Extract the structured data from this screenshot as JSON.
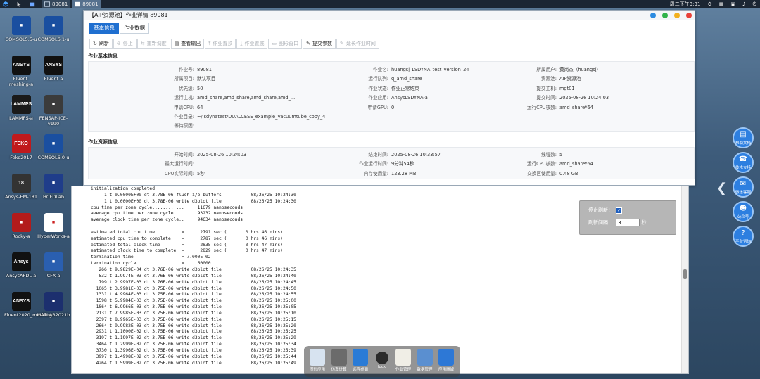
{
  "taskbar": {
    "tasks": [
      "89081",
      "89081"
    ],
    "clock": "周二下午3:31"
  },
  "desktop_icons": [
    {
      "label": "COMSOL5.5-u",
      "badge": "",
      "color": "#1a4fa0"
    },
    {
      "label": "COMSOL6.1-u",
      "badge": "",
      "color": "#1a4fa0"
    },
    {
      "label": "Fluent-meshing-a",
      "badge": "ANSYS",
      "color": "#111111"
    },
    {
      "label": "Fluent-a",
      "badge": "ANSYS",
      "color": "#111111"
    },
    {
      "label": "LAMMPS-a",
      "badge": "LAMMPS",
      "color": "#1a1a1a"
    },
    {
      "label": "FENSAP-ICE-v190",
      "badge": "",
      "color": "#3b3b3b"
    },
    {
      "label": "Feko2017",
      "badge": "FEKO",
      "color": "#c0191c"
    },
    {
      "label": "COMSOL6.0-u",
      "badge": "",
      "color": "#1a4fa0"
    },
    {
      "label": "Ansys-EM-181",
      "badge": "18",
      "color": "#333333"
    },
    {
      "label": "HCFDLab",
      "badge": "",
      "color": "#1f3d8a"
    },
    {
      "label": "Rocky-a",
      "badge": "",
      "color": "#b31b1b"
    },
    {
      "label": "HyperWorks-a",
      "badge": "",
      "color": "#ffffff"
    },
    {
      "label": "AnsysAPDL-a",
      "badge": "Ansys",
      "color": "#111111"
    },
    {
      "label": "CFX-a",
      "badge": "",
      "color": "#2a5fb0"
    },
    {
      "label": "Fluent2020_meshing",
      "badge": "ANSYS",
      "color": "#111111"
    },
    {
      "label": "MATLAB2021b",
      "badge": "",
      "color": "#1c2f6e"
    }
  ],
  "window": {
    "title": "【AIP资源池】作业详情 89081",
    "tabs": [
      "基本信息",
      "作业数据"
    ],
    "toolbar": [
      "刷新",
      "停止",
      "重新调度",
      "查看输出",
      "作业置顶",
      "作业置底",
      "图形窗口",
      "提交参数",
      "延长作业时间"
    ],
    "basic_section": "作业基本信息",
    "basic": {
      "col1": [
        [
          "作业号:",
          "89081"
        ],
        [
          "所属项目:",
          "默认项目"
        ],
        [
          "优先级:",
          "50"
        ],
        [
          "运行主机:",
          "amd_share,amd_share,amd_share,amd_..."
        ],
        [
          "申请CPU:",
          "64"
        ],
        [
          "作业目录:",
          "~/lsdynatest/DUALCESE_example_Vacuumtube_copy_4"
        ],
        [
          "等待原因:",
          ""
        ]
      ],
      "col2": [
        [
          "作业名:",
          "huangsj_LSDYNA_test_version_24"
        ],
        [
          "运行队列:",
          "q_amd_share"
        ],
        [
          "作业状态:",
          "作业正常结束"
        ],
        [
          "作业应用:",
          "AnsysLSDYNA-a"
        ],
        [
          "申请GPU:",
          "0"
        ]
      ],
      "col3": [
        [
          "所属用户:",
          "黄尚杰（huangsj）"
        ],
        [
          "资源池:",
          "AIP资源池"
        ],
        [
          "提交主机:",
          "mgt01"
        ],
        [
          "提交时间:",
          "2025-08-26 10:24:03"
        ],
        [
          "运行CPU核数:",
          "amd_share*64"
        ]
      ]
    },
    "resource_section": "作业资源信息",
    "resource": {
      "col1": [
        [
          "开始时间:",
          "2025-08-26 10:24:03"
        ],
        [
          "最大运行时间:",
          ""
        ],
        [
          "CPU实际时间:",
          "5秒"
        ]
      ],
      "col2": [
        [
          "结束时间:",
          "2025-08-26 10:33:57"
        ],
        [
          "作业运行时间:",
          "9分钟54秒"
        ],
        [
          "内存使用量:",
          "123.28 MB"
        ]
      ],
      "col3": [
        [
          "线程数:",
          "5"
        ],
        [
          "运行CPU核数:",
          "amd_share*64"
        ],
        [
          "交换区使用量:",
          "0.48 GB"
        ]
      ]
    }
  },
  "log": {
    "lines": [
      "initialization completed",
      "     1 t 0.0000E+00 dt 3.78E-06 flush i/o buffers           08/26/25 10:24:30",
      "     1 t 0.0000E+00 dt 3.78E-06 write d3plot file           08/26/25 10:24:30",
      "cpu time per zone cycle............     11679 nanoseconds",
      "average cpu time per zone cycle....     93232 nanoseconds",
      "average clock time per zone cycle..     94634 nanoseconds",
      "",
      "estimated total cpu time          =      2791 sec (       0 hrs 46 mins)",
      "estimated cpu time to complete    =      2787 sec (       0 hrs 46 mins)",
      "estimated total clock time        =      2835 sec (       0 hrs 47 mins)",
      "estimated clock time to complete  =      2829 sec (       0 hrs 47 mins)",
      "termination time                  = 7.000E-02",
      "termination cycle                 =     60000",
      "   266 t 9.9829E-04 dt 3.76E-06 write d3plot file           08/26/25 10:24:35",
      "   532 t 1.9974E-03 dt 3.76E-06 write d3plot file           08/26/25 10:24:40",
      "   799 t 2.9997E-03 dt 3.76E-06 write d3plot file           08/26/25 10:24:45",
      "  1065 t 3.9981E-03 dt 3.75E-06 write d3plot file           08/26/25 10:24:50",
      "  1331 t 4.9964E-03 dt 3.75E-06 write d3plot file           08/26/25 10:24:55",
      "  1598 t 5.9984E-03 dt 3.75E-06 write d3plot file           08/26/25 10:25:00",
      "  1864 t 6.9966E-03 dt 3.75E-06 write d3plot file           08/26/25 10:25:05",
      "  2131 t 7.9985E-03 dt 3.75E-06 write d3plot file           08/26/25 10:25:10",
      "  2397 t 8.9965E-03 dt 3.75E-06 write d3plot file           08/26/25 10:25:15",
      "  2664 t 9.9982E-03 dt 3.75E-06 write d3plot file           08/26/25 10:25:20",
      "  2931 t 1.1000E-02 dt 3.75E-06 write d3plot file           08/26/25 10:25:25",
      "  3197 t 1.1997E-02 dt 3.75E-06 write d3plot file           08/26/25 10:25:29",
      "  3464 t 1.2999E-02 dt 3.75E-06 write d3plot file           08/26/25 10:25:34",
      "  3730 t 1.3996E-02 dt 3.75E-06 write d3plot file           08/26/25 10:25:39",
      "  3997 t 1.4998E-02 dt 3.75E-06 write d3plot file           08/26/25 10:25:44",
      "  4264 t 1.5999E-02 dt 3.75E-06 write d3plot file           08/26/25 10:25:49"
    ]
  },
  "refresh": {
    "stop_label": "停止刷新：",
    "stop_checked": true,
    "interval_label": "刷新间隔：",
    "interval_value": "3",
    "unit": "秒"
  },
  "right_dock": [
    "帮助文档",
    "技术支持",
    "微信客服",
    "公众号",
    "平台咨询"
  ],
  "bottom_dock": [
    "图形应用",
    "仿真计算",
    "远程桌面",
    "lock",
    "作业管理",
    "数据管理",
    "应用商城"
  ]
}
